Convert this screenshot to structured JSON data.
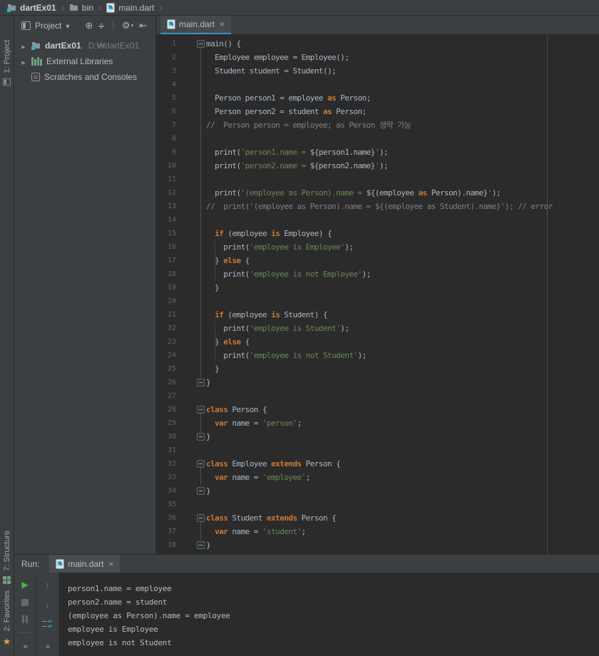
{
  "colors": {
    "panel_bg": "#3C3F41",
    "editor_bg": "#2B2B2B",
    "tab_underline": "#3C93C5",
    "keyword": "#CC7832",
    "string": "#6A8759",
    "comment": "#808080",
    "code_text": "#A9B7C6",
    "run_green": "#49B648",
    "favorites_star": "#D9A343"
  },
  "breadcrumbs": {
    "items": [
      {
        "icon": "project-folder-icon",
        "label": "dartEx01",
        "bold": true
      },
      {
        "icon": "folder-icon",
        "label": "bin",
        "bold": false
      },
      {
        "icon": "dart-file-icon",
        "label": "main.dart",
        "bold": false
      }
    ]
  },
  "left_stripe": {
    "top_label": "1: Project",
    "bottom_labels": [
      "7: Structure",
      "2: Favorites"
    ]
  },
  "project_panel": {
    "title": "Project",
    "header_icons": [
      "locate-icon",
      "collapse-all-icon",
      "divider",
      "settings-icon",
      "hide-sidebar-icon"
    ],
    "tree": [
      {
        "arrow": true,
        "icon": "project-folder-icon",
        "label": "dartEx01",
        "hint": "D:₩dartEx01",
        "bold": true
      },
      {
        "arrow": true,
        "icon": "libraries-icon",
        "label": "External Libraries",
        "hint": "",
        "bold": false
      },
      {
        "arrow": false,
        "icon": "scratches-icon",
        "label": "Scratches and Consoles",
        "hint": "",
        "bold": false
      }
    ]
  },
  "editor": {
    "tab": {
      "icon": "dart-file-icon",
      "label": "main.dart",
      "close": "×"
    },
    "lines": [
      {
        "n": 1,
        "fold": "open",
        "t": [
          [
            "d",
            "main() {"
          ]
        ]
      },
      {
        "n": 2,
        "t": [
          [
            "d",
            "  Employee employee = Employee();"
          ]
        ]
      },
      {
        "n": 3,
        "t": [
          [
            "d",
            "  Student student = Student();"
          ]
        ]
      },
      {
        "n": 4,
        "t": []
      },
      {
        "n": 5,
        "t": [
          [
            "d",
            "  Person person1 = employee "
          ],
          [
            "k",
            "as"
          ],
          [
            "d",
            " Person;"
          ]
        ]
      },
      {
        "n": 6,
        "t": [
          [
            "d",
            "  Person person2 = student "
          ],
          [
            "k",
            "as"
          ],
          [
            "d",
            " Person;"
          ]
        ]
      },
      {
        "n": 7,
        "t": [
          [
            "c",
            "//  Person person = employee; as Person 생략 가능"
          ]
        ]
      },
      {
        "n": 8,
        "t": []
      },
      {
        "n": 9,
        "t": [
          [
            "d",
            "  print("
          ],
          [
            "s",
            "'person1.name = "
          ],
          [
            "d",
            "${person1.name}"
          ],
          [
            "s",
            "'"
          ],
          [
            "d",
            ");"
          ]
        ]
      },
      {
        "n": 10,
        "t": [
          [
            "d",
            "  print("
          ],
          [
            "s",
            "'person2.name = "
          ],
          [
            "d",
            "${person2.name}"
          ],
          [
            "s",
            "'"
          ],
          [
            "d",
            ");"
          ]
        ]
      },
      {
        "n": 11,
        "t": []
      },
      {
        "n": 12,
        "t": [
          [
            "d",
            "  print("
          ],
          [
            "s",
            "'(employee as Person).name = "
          ],
          [
            "d",
            "${(employee "
          ],
          [
            "k",
            "as"
          ],
          [
            "d",
            " Person).name}"
          ],
          [
            "s",
            "'"
          ],
          [
            "d",
            ");"
          ]
        ]
      },
      {
        "n": 13,
        "t": [
          [
            "c",
            "//  print('(employee as Person).name = ${(employee as Student).name}'); // error"
          ]
        ]
      },
      {
        "n": 14,
        "t": []
      },
      {
        "n": 15,
        "t": [
          [
            "d",
            "  "
          ],
          [
            "k",
            "if"
          ],
          [
            "d",
            " (employee "
          ],
          [
            "k",
            "is"
          ],
          [
            "d",
            " Employee) {"
          ]
        ]
      },
      {
        "n": 16,
        "t": [
          [
            "d",
            "    print("
          ],
          [
            "s",
            "'employee is Employee'"
          ],
          [
            "d",
            ");"
          ]
        ]
      },
      {
        "n": 17,
        "t": [
          [
            "d",
            "  } "
          ],
          [
            "k",
            "else"
          ],
          [
            "d",
            " {"
          ]
        ]
      },
      {
        "n": 18,
        "t": [
          [
            "d",
            "    print("
          ],
          [
            "s",
            "'employee is not Employee'"
          ],
          [
            "d",
            ");"
          ]
        ]
      },
      {
        "n": 19,
        "t": [
          [
            "d",
            "  }"
          ]
        ]
      },
      {
        "n": 20,
        "t": []
      },
      {
        "n": 21,
        "t": [
          [
            "d",
            "  "
          ],
          [
            "k",
            "if"
          ],
          [
            "d",
            " (employee "
          ],
          [
            "k",
            "is"
          ],
          [
            "d",
            " Student) {"
          ]
        ]
      },
      {
        "n": 22,
        "t": [
          [
            "d",
            "    print("
          ],
          [
            "s",
            "'employee is Student'"
          ],
          [
            "d",
            ");"
          ]
        ]
      },
      {
        "n": 23,
        "t": [
          [
            "d",
            "  } "
          ],
          [
            "k",
            "else"
          ],
          [
            "d",
            " {"
          ]
        ]
      },
      {
        "n": 24,
        "t": [
          [
            "d",
            "    print("
          ],
          [
            "s",
            "'employee is not Student'"
          ],
          [
            "d",
            ");"
          ]
        ]
      },
      {
        "n": 25,
        "t": [
          [
            "d",
            "  }"
          ]
        ]
      },
      {
        "n": 26,
        "fold": "close",
        "t": [
          [
            "d",
            "}"
          ]
        ]
      },
      {
        "n": 27,
        "t": []
      },
      {
        "n": 28,
        "fold": "open",
        "t": [
          [
            "k",
            "class"
          ],
          [
            "d",
            " Person {"
          ]
        ]
      },
      {
        "n": 29,
        "t": [
          [
            "d",
            "  "
          ],
          [
            "k",
            "var"
          ],
          [
            "d",
            " name = "
          ],
          [
            "s",
            "'person'"
          ],
          [
            "d",
            ";"
          ]
        ]
      },
      {
        "n": 30,
        "fold": "close",
        "t": [
          [
            "d",
            "}"
          ]
        ]
      },
      {
        "n": 31,
        "t": []
      },
      {
        "n": 32,
        "fold": "open",
        "t": [
          [
            "k",
            "class"
          ],
          [
            "d",
            " Employee "
          ],
          [
            "k",
            "extends"
          ],
          [
            "d",
            " Person {"
          ]
        ]
      },
      {
        "n": 33,
        "t": [
          [
            "d",
            "  "
          ],
          [
            "k",
            "var"
          ],
          [
            "d",
            " name = "
          ],
          [
            "s",
            "'employee'"
          ],
          [
            "d",
            ";"
          ]
        ]
      },
      {
        "n": 34,
        "fold": "close",
        "t": [
          [
            "d",
            "}"
          ]
        ]
      },
      {
        "n": 35,
        "t": []
      },
      {
        "n": 36,
        "fold": "open",
        "t": [
          [
            "k",
            "class"
          ],
          [
            "d",
            " Student "
          ],
          [
            "k",
            "extends"
          ],
          [
            "d",
            " Person {"
          ]
        ]
      },
      {
        "n": 37,
        "t": [
          [
            "d",
            "  "
          ],
          [
            "k",
            "var"
          ],
          [
            "d",
            " name = "
          ],
          [
            "s",
            "'student'"
          ],
          [
            "d",
            ";"
          ]
        ]
      },
      {
        "n": 38,
        "fold": "close",
        "t": [
          [
            "d",
            "}"
          ]
        ]
      }
    ],
    "guides": {
      "fold_pairs": [
        [
          1,
          26
        ],
        [
          28,
          30
        ],
        [
          32,
          34
        ],
        [
          36,
          38
        ]
      ],
      "indent_guides": [
        {
          "from": 16,
          "to": 18,
          "col": 2
        },
        {
          "from": 22,
          "to": 24,
          "col": 2
        }
      ]
    }
  },
  "run_panel": {
    "label": "Run:",
    "tab": {
      "icon": "dart-file-icon",
      "label": "main.dart",
      "close": "×"
    },
    "toolbar_col1": [
      "run-icon",
      "stop-icon",
      "pause-icon"
    ],
    "toolbar_col2": [
      "up-arrow-icon",
      "down-arrow-icon",
      "softwrap-icon"
    ],
    "console": [
      "person1.name = employee",
      "person2.name = student",
      "(employee as Person).name = employee",
      "employee is Employee",
      "employee is not Student"
    ]
  }
}
